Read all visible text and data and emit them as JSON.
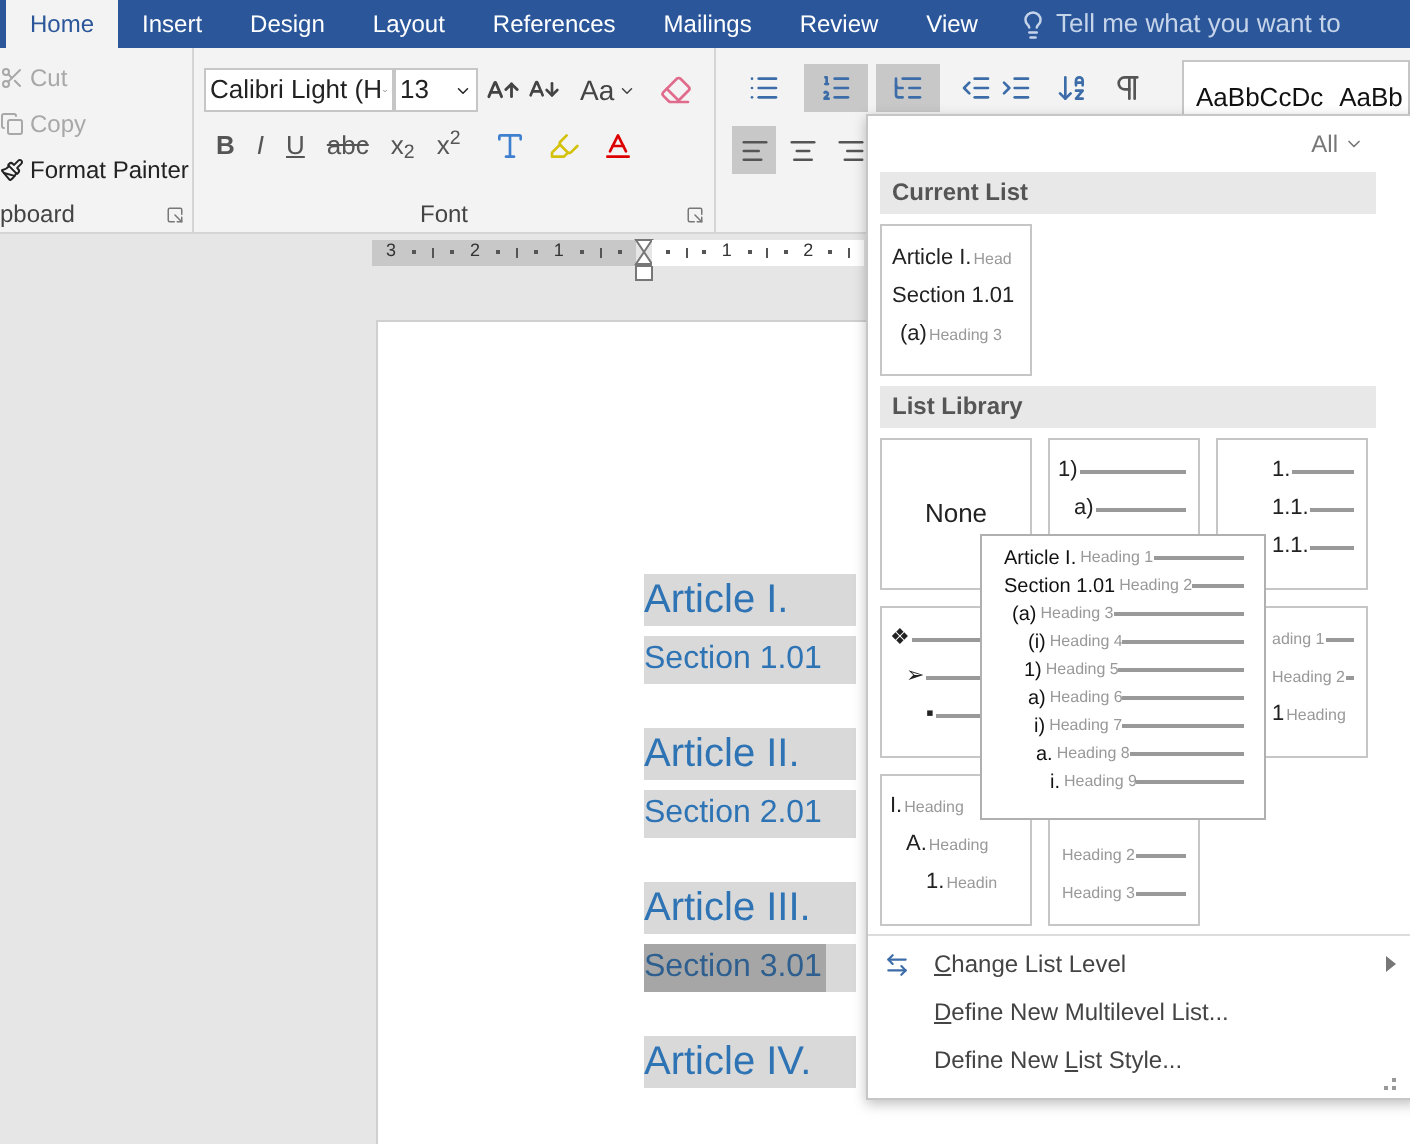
{
  "ribbon_tabs": [
    {
      "label": "Home",
      "selected": true
    },
    {
      "label": "Insert",
      "selected": false
    },
    {
      "label": "Design",
      "selected": false
    },
    {
      "label": "Layout",
      "selected": false
    },
    {
      "label": "References",
      "selected": false
    },
    {
      "label": "Mailings",
      "selected": false
    },
    {
      "label": "Review",
      "selected": false
    },
    {
      "label": "View",
      "selected": false
    }
  ],
  "tell_me": {
    "placeholder": "Tell me what you want to"
  },
  "clipboard": {
    "items": [
      {
        "label": "Cut",
        "disabled": true
      },
      {
        "label": "Copy",
        "disabled": true
      },
      {
        "label": "Format Painter",
        "disabled": false
      }
    ],
    "group_label": "pboard"
  },
  "font": {
    "font_name": "Calibri Light (H",
    "font_size": "13",
    "case_button": "Aa",
    "format_buttons": [
      "B",
      "I",
      "U",
      "abc",
      "x$_{2}$",
      "x$^{2}$"
    ],
    "group_label": "Font"
  },
  "paragraph": {
    "list_buttons": [
      {
        "selected": false
      },
      {
        "selected": true
      },
      {
        "selected": true
      }
    ],
    "align_buttons": [
      {
        "selected": true
      },
      {
        "selected": false
      },
      {
        "selected": false
      }
    ]
  },
  "styles": [
    "AaBbCcDc",
    "AaBb"
  ],
  "ruler": {
    "left_numbers": [
      "3",
      "2",
      "1"
    ],
    "right_numbers": [
      "1",
      "2"
    ]
  },
  "document": {
    "headings": [
      {
        "kind": "article",
        "number": "Article I.",
        "selected": false
      },
      {
        "kind": "section",
        "number": "Section 1.01",
        "selected": false
      },
      {
        "kind": "article",
        "number": "Article II.",
        "selected": false
      },
      {
        "kind": "section",
        "number": "Section 2.01",
        "selected": false
      },
      {
        "kind": "article",
        "number": "Article III.",
        "selected": false
      },
      {
        "kind": "section",
        "number": "Section 3.01",
        "selected": true
      },
      {
        "kind": "article",
        "number": "Article IV.",
        "selected": false
      }
    ]
  },
  "multilevel_menu": {
    "filter": "All",
    "current_list": {
      "title": "Current List",
      "rows": [
        {
          "num": "Article I.",
          "label": "Head"
        },
        {
          "num": "Section 1.01",
          "label": ""
        },
        {
          "num": "(a)",
          "label": "Heading 3"
        }
      ]
    },
    "list_library": {
      "title": "List Library",
      "tiles": [
        {
          "kind": "none",
          "label": "None"
        },
        {
          "kind": "rows",
          "rows": [
            {
              "num": "1)",
              "line": true
            },
            {
              "num": "a)",
              "line": true
            }
          ]
        },
        {
          "kind": "right_rows",
          "rows": [
            {
              "num": "1.",
              "line": true
            },
            {
              "num": "1.1.",
              "line": true
            },
            {
              "num": "1.1.",
              "line": true
            }
          ]
        },
        {
          "kind": "rows",
          "rows": [
            {
              "num": "❖",
              "line": true
            },
            {
              "num": "➢",
              "line": true
            },
            {
              "num": "▪",
              "line": true
            }
          ]
        },
        {
          "kind": "hidden"
        },
        {
          "kind": "right_rows",
          "rows": [
            {
              "label": "ading 1",
              "line": true
            },
            {
              "label": "Heading 2",
              "line": true
            },
            {
              "num": "1",
              "label": "Heading",
              "line": false
            }
          ]
        },
        {
          "kind": "rows",
          "rows": [
            {
              "num": "I.",
              "label": "Heading",
              "line": false
            },
            {
              "num": "A.",
              "label": "Heading",
              "line": false
            },
            {
              "num": "1.",
              "label": "Headin",
              "line": false
            }
          ]
        },
        {
          "kind": "lower_rows",
          "rows": [
            {
              "label": "Heading 2",
              "line": true
            },
            {
              "label": "Heading 3",
              "line": true
            }
          ]
        }
      ]
    },
    "preview": {
      "rows": [
        {
          "num": "Article I.",
          "label": "Heading 1"
        },
        {
          "num": "Section 1.01",
          "label": "Heading 2"
        },
        {
          "num": "(a)",
          "label": "Heading 3"
        },
        {
          "num": "(i)",
          "label": "Heading 4"
        },
        {
          "num": "1)",
          "label": "Heading 5"
        },
        {
          "num": "a)",
          "label": "Heading 6"
        },
        {
          "num": "i)",
          "label": "Heading 7"
        },
        {
          "num": "a.",
          "label": "Heading 8"
        },
        {
          "num": "i.",
          "label": "Heading 9"
        }
      ]
    },
    "commands": [
      {
        "key": "C",
        "rest": "hange List Level",
        "submenu": true
      },
      {
        "key": "D",
        "rest": "efine New Multilevel List...",
        "submenu": false
      },
      {
        "before": "Define New ",
        "key": "L",
        "rest": "ist Style...",
        "submenu": false
      }
    ]
  }
}
